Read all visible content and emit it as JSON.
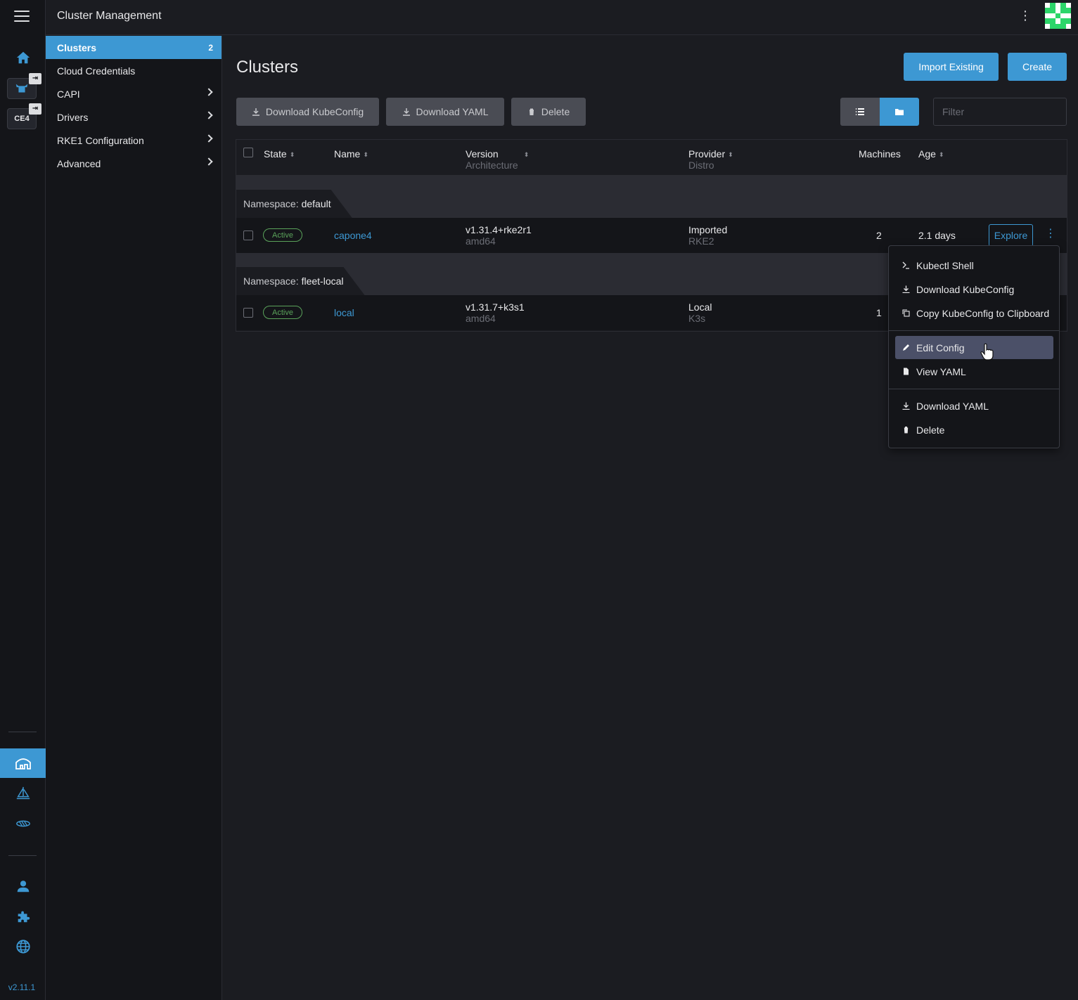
{
  "app": {
    "title": "Cluster Management",
    "version": "v2.11.1"
  },
  "rail": {
    "cluster_chip_label": "CE4",
    "pin_glyph": "⇥"
  },
  "sidenav": {
    "items": [
      {
        "label": "Clusters",
        "count": "2",
        "active": true
      },
      {
        "label": "Cloud Credentials"
      },
      {
        "label": "CAPI",
        "expandable": true
      },
      {
        "label": "Drivers",
        "expandable": true
      },
      {
        "label": "RKE1 Configuration",
        "expandable": true
      },
      {
        "label": "Advanced",
        "expandable": true
      }
    ]
  },
  "page": {
    "title": "Clusters",
    "import_label": "Import Existing",
    "create_label": "Create",
    "bulk": {
      "download_kubeconfig": "Download KubeConfig",
      "download_yaml": "Download YAML",
      "delete": "Delete"
    },
    "filter_placeholder": "Filter"
  },
  "table": {
    "headers": {
      "state": "State",
      "name": "Name",
      "version": "Version",
      "architecture": "Architecture",
      "provider": "Provider",
      "distro": "Distro",
      "machines": "Machines",
      "age": "Age"
    },
    "groups": [
      {
        "prefix": "Namespace:",
        "namespace": "default",
        "rows": [
          {
            "state": "Active",
            "name": "capone4",
            "version": "v1.31.4+rke2r1",
            "arch": "amd64",
            "provider": "Imported",
            "distro": "RKE2",
            "machines": "2",
            "age": "2.1 days",
            "action": "Explore"
          }
        ]
      },
      {
        "prefix": "Namespace:",
        "namespace": "fleet-local",
        "rows": [
          {
            "state": "Active",
            "name": "local",
            "version": "v1.31.7+k3s1",
            "arch": "amd64",
            "provider": "Local",
            "distro": "K3s",
            "machines": "1"
          }
        ]
      }
    ]
  },
  "menu": {
    "items": [
      {
        "label": "Kubectl Shell",
        "icon": "terminal-icon"
      },
      {
        "label": "Download KubeConfig",
        "icon": "download-icon"
      },
      {
        "label": "Copy KubeConfig to Clipboard",
        "icon": "copy-icon"
      },
      {
        "label": "Edit Config",
        "icon": "pencil-icon",
        "hovered": true
      },
      {
        "label": "View YAML",
        "icon": "file-icon"
      },
      {
        "label": "Download YAML",
        "icon": "download-icon"
      },
      {
        "label": "Delete",
        "icon": "trash-icon"
      }
    ]
  },
  "colors": {
    "accent": "#3d98d3",
    "active_green": "#5aa25a",
    "background": "#1b1c21",
    "panel": "#141519"
  }
}
